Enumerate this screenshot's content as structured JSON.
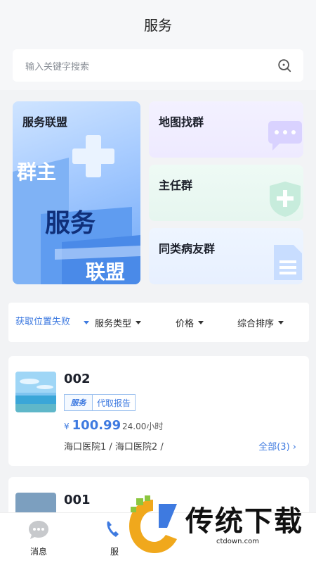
{
  "header": {
    "title": "服务"
  },
  "search": {
    "placeholder": "输入关键字搜索"
  },
  "banner": {
    "title": "服务联盟",
    "art_words": [
      "群主",
      "服务",
      "联盟"
    ]
  },
  "tiles": [
    {
      "label": "地图找群",
      "icon": "chat-bubble-icon"
    },
    {
      "label": "主任群",
      "icon": "shield-plus-icon"
    },
    {
      "label": "同类病友群",
      "icon": "document-icon"
    }
  ],
  "filters": {
    "location": "获取位置失败",
    "service_type": "服务类型",
    "price": "价格",
    "sort": "综合排序"
  },
  "cards": [
    {
      "title": "002",
      "tag_logo": "服务",
      "tag": "代取报告",
      "currency": "¥",
      "price": "100.99",
      "duration": "24.00小时",
      "hospitals": "海口医院1 / 海口医院2 /",
      "all_link": "全部(3)"
    },
    {
      "title": "001"
    }
  ],
  "tabbar": {
    "tabs": [
      {
        "label": "消息",
        "icon": "message-icon"
      },
      {
        "label": "服",
        "icon": "service-icon"
      }
    ]
  },
  "watermark": {
    "text": "传统下载",
    "sub": "ctdown.com"
  },
  "colors": {
    "accent": "#3e7ae0",
    "background": "#f2f3f5"
  }
}
